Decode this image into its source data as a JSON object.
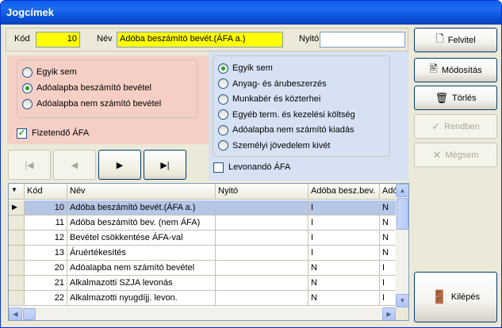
{
  "window": {
    "title": "Jogcímek"
  },
  "form": {
    "kod_label": "Kód",
    "kod_value": "10",
    "nev_label": "Név",
    "nev_value": "Adóba beszámító bevét.(ÁFA a.)",
    "nyito_label": "Nyitó",
    "nyito_value": ""
  },
  "left_group": {
    "options": [
      "Egyik sem",
      "Adóalapba beszámító bevétel",
      "Adóalapba nem számító bevétel"
    ],
    "selected_index": 1,
    "checkbox_label": "Fizetendő ÁFA",
    "checkbox_checked": true
  },
  "right_group": {
    "options": [
      "Egyik sem",
      "Anyag- és árubeszerzés",
      "Munkabér és közterhei",
      "Egyéb term. és kezelési költség",
      "Adóalapba nem számító kiadás",
      "Személyi jövedelem kivét"
    ],
    "selected_index": 0,
    "checkbox_label": "Levonandó ÁFA",
    "checkbox_checked": false
  },
  "nav_buttons": [
    {
      "name": "first",
      "glyph": "|◀",
      "enabled": false
    },
    {
      "name": "prev",
      "glyph": "◀",
      "enabled": false
    },
    {
      "name": "next",
      "glyph": "▶",
      "enabled": true
    },
    {
      "name": "last",
      "glyph": "▶|",
      "enabled": true
    }
  ],
  "actions": {
    "felvitel": "Felvitel",
    "modositas": "Módosítás",
    "torles": "Törlés",
    "rendben": "Rendben",
    "megsem": "Mégsem",
    "kilepes": "Kilépés"
  },
  "table": {
    "columns": [
      "Kód",
      "Név",
      "Nyitó",
      "Adóba besz.bev.",
      "Adó"
    ],
    "rows": [
      [
        "10",
        "Adóba beszámító bevét.(ÁFA a.)",
        "",
        "I",
        "N"
      ],
      [
        "11",
        "Adóba beszámító bev. (nem ÁFA)",
        "",
        "I",
        "N"
      ],
      [
        "12",
        "Bevétel csökkentése ÁFA-val",
        "",
        "I",
        "N"
      ],
      [
        "13",
        "Áruértékesítés",
        "",
        "I",
        "N"
      ],
      [
        "20",
        "Adóalapba nem számító bevétel",
        "",
        "N",
        "I"
      ],
      [
        "21",
        "Alkalmazotti SZJA levonás",
        "",
        "N",
        "I"
      ],
      [
        "22",
        "Alkalmazotti nyugdíjj. levon.",
        "",
        "N",
        "I"
      ]
    ],
    "selected_row": 0
  }
}
